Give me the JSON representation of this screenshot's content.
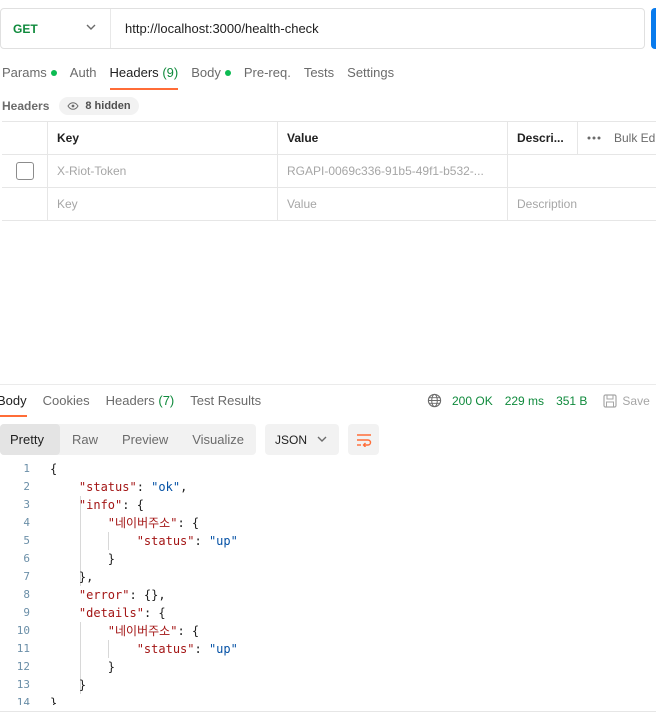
{
  "request": {
    "method": "GET",
    "url": "http://localhost:3000/health-check"
  },
  "request_tabs": [
    {
      "label": "Params",
      "dot": true
    },
    {
      "label": "Auth"
    },
    {
      "label": "Headers",
      "count": "(9)",
      "active": true
    },
    {
      "label": "Body",
      "dot": true
    },
    {
      "label": "Pre-req."
    },
    {
      "label": "Tests"
    },
    {
      "label": "Settings"
    }
  ],
  "headers_section": {
    "label": "Headers",
    "hidden_label": "8 hidden"
  },
  "table": {
    "columns": {
      "key": "Key",
      "value": "Value",
      "description": "Descri...",
      "bulk_edit": "Bulk Edi"
    },
    "rows": [
      {
        "key": "X-Riot-Token",
        "value": "RGAPI-0069c336-91b5-49f1-b532-...",
        "description": ""
      }
    ],
    "placeholder": {
      "key": "Key",
      "value": "Value",
      "description": "Description"
    }
  },
  "response_tabs": [
    {
      "label": "Body",
      "active": true
    },
    {
      "label": "Cookies"
    },
    {
      "label": "Headers",
      "count": "(7)"
    },
    {
      "label": "Test Results"
    }
  ],
  "response_stats": {
    "status": "200 OK",
    "time": "229 ms",
    "size": "351 B",
    "save_label": "Save"
  },
  "view_modes": [
    "Pretty",
    "Raw",
    "Preview",
    "Visualize"
  ],
  "format": "JSON",
  "code_lines": [
    {
      "n": "1",
      "t": "{"
    },
    {
      "n": "2",
      "t": "    \"status\": \"ok\","
    },
    {
      "n": "3",
      "t": "    \"info\": {"
    },
    {
      "n": "4",
      "t": "        \"네이버주소\": {"
    },
    {
      "n": "5",
      "t": "            \"status\": \"up\""
    },
    {
      "n": "6",
      "t": "        }"
    },
    {
      "n": "7",
      "t": "    },"
    },
    {
      "n": "8",
      "t": "    \"error\": {},"
    },
    {
      "n": "9",
      "t": "    \"details\": {"
    },
    {
      "n": "10",
      "t": "        \"네이버주소\": {"
    },
    {
      "n": "11",
      "t": "            \"status\": \"up\""
    },
    {
      "n": "12",
      "t": "        }"
    },
    {
      "n": "13",
      "t": "    }"
    },
    {
      "n": "14",
      "t": "}"
    }
  ],
  "colors": {
    "accent": "#ff6c37",
    "success": "#0f8a3c",
    "method": "#0f8a3c",
    "json_key": "#a31515",
    "json_string": "#0451a5"
  }
}
